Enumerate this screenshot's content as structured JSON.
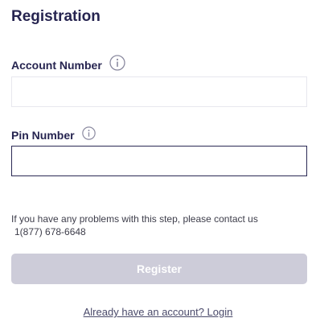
{
  "form": {
    "title": "Registration",
    "account_number": {
      "label": "Account Number",
      "value": "",
      "placeholder": "",
      "info_icon": "info-circle-icon"
    },
    "pin_number": {
      "label": "Pin Number",
      "value": "",
      "placeholder": "",
      "info_icon": "info-circle-icon"
    },
    "help_text": "If you have any problems with this step, please contact us",
    "help_phone": "1(877) 678-6648",
    "register_label": "Register",
    "login_link": "Already have an account? Login"
  },
  "colors": {
    "heading": "#262450",
    "button_disabled": "#cdccd9",
    "input_focus_border": "#2b2955",
    "input_border": "#e7e7ee",
    "info_icon": "#8b8aa0"
  }
}
